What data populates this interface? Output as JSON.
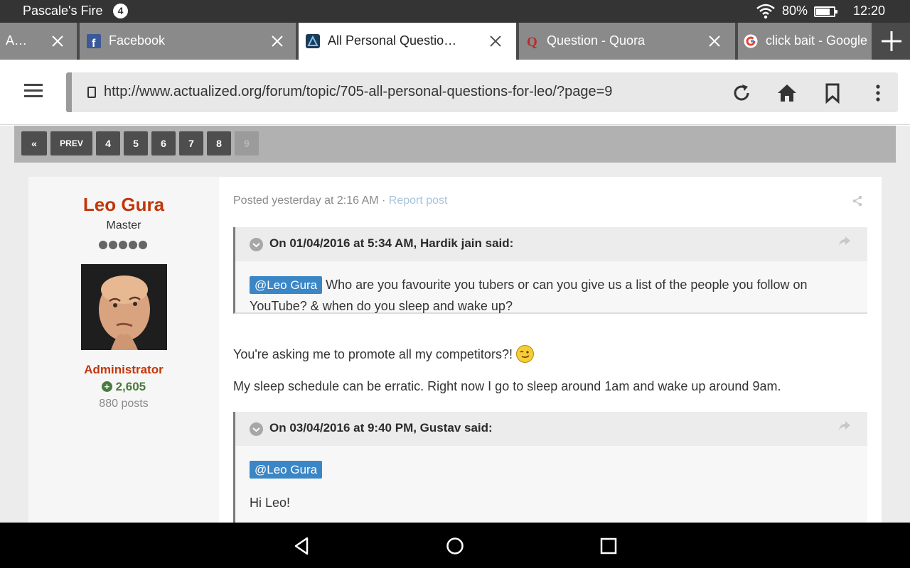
{
  "status_bar": {
    "app_title": "Pascale's Fire",
    "notification_count": "4",
    "battery_text": "80%",
    "battery_level": 0.8,
    "time": "12:20"
  },
  "tabs": [
    {
      "title": "A…",
      "favicon": "generic",
      "active": false
    },
    {
      "title": "Facebook",
      "favicon": "facebook-icon",
      "active": false
    },
    {
      "title": "All Personal Questio…",
      "favicon": "actualized-icon",
      "active": true
    },
    {
      "title": "Question - Quora",
      "favicon": "quora-icon",
      "active": false
    },
    {
      "title": "click bait - Google",
      "favicon": "google-icon",
      "active": false
    }
  ],
  "address_bar": {
    "url": "http://www.actualized.org/forum/topic/705-all-personal-questions-for-leo/?page=9"
  },
  "pagination": {
    "first": "«",
    "prev": "PREV",
    "pages": [
      "4",
      "5",
      "6",
      "7",
      "8",
      "9"
    ],
    "current": "9"
  },
  "author": {
    "name": "Leo Gura",
    "rank": "Master",
    "pips": 5,
    "group": "Administrator",
    "reputation": "2,605",
    "rep_sign": "+",
    "post_count": "880 posts"
  },
  "post": {
    "posted": "Posted yesterday at 2:16 AM",
    "separator": " · ",
    "report": "Report post",
    "quote1": {
      "cite": "On 01/04/2016 at 5:34 AM, Hardik jain said:",
      "mention": "@Leo Gura",
      "text": " Who are you favourite you tubers or can you give us a list of the people you follow on YouTube? & when do you sleep and wake up?"
    },
    "reply1": "You're asking me to promote all my competitors?! ",
    "reply2": "My sleep schedule can be erratic. Right now I go to sleep around 1am and wake up around 9am.",
    "quote2": {
      "cite": "On 03/04/2016 at 9:40 PM, Gustav said:",
      "mention": "@Leo Gura",
      "text": "Hi Leo!"
    }
  },
  "colors": {
    "author_name": "#c2360a",
    "reputation": "#4a7a3d",
    "mention_bg": "#3a86c6",
    "status_bar": "#343434"
  }
}
